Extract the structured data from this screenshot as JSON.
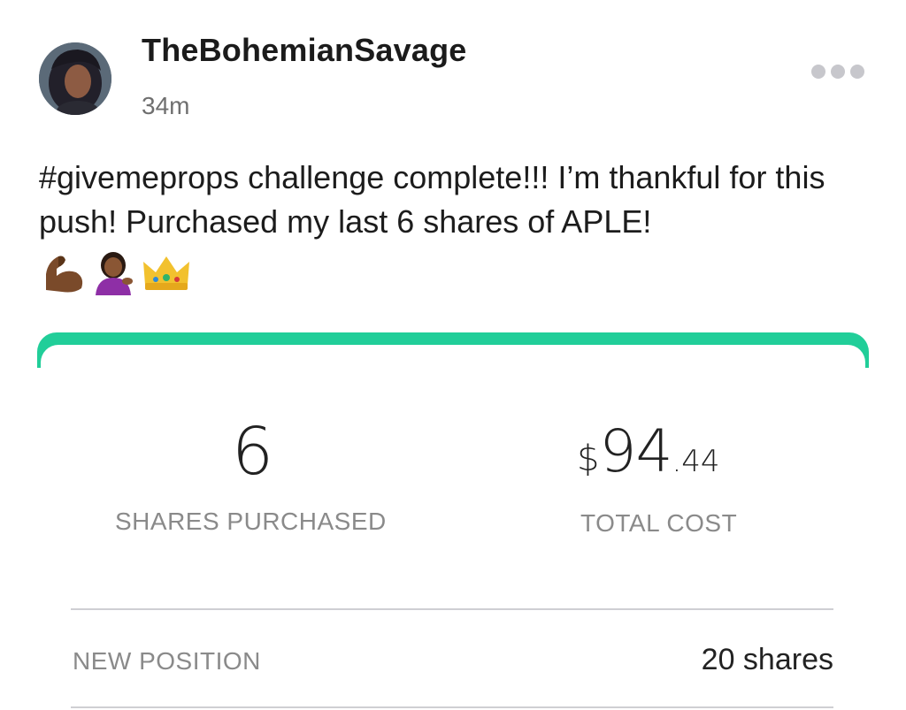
{
  "post": {
    "username": "TheBohemianSavage",
    "timestamp": "34m",
    "text": "#givemeprops challenge complete!!! I’m thankful for this push! Purchased my last 6 shares of APLE!",
    "emojis": [
      "flexed-biceps-icon",
      "person-tipping-hand-icon",
      "crown-icon"
    ],
    "more_icon": "more-dots-icon"
  },
  "order_card": {
    "accent_color": "#21ce99",
    "shares": {
      "value": "6",
      "label": "SHARES PURCHASED"
    },
    "total_cost": {
      "currency": "$",
      "whole": "94",
      "cents": ".44",
      "label": "TOTAL COST"
    },
    "new_position": {
      "label": "NEW POSITION",
      "value": "20 shares"
    }
  }
}
